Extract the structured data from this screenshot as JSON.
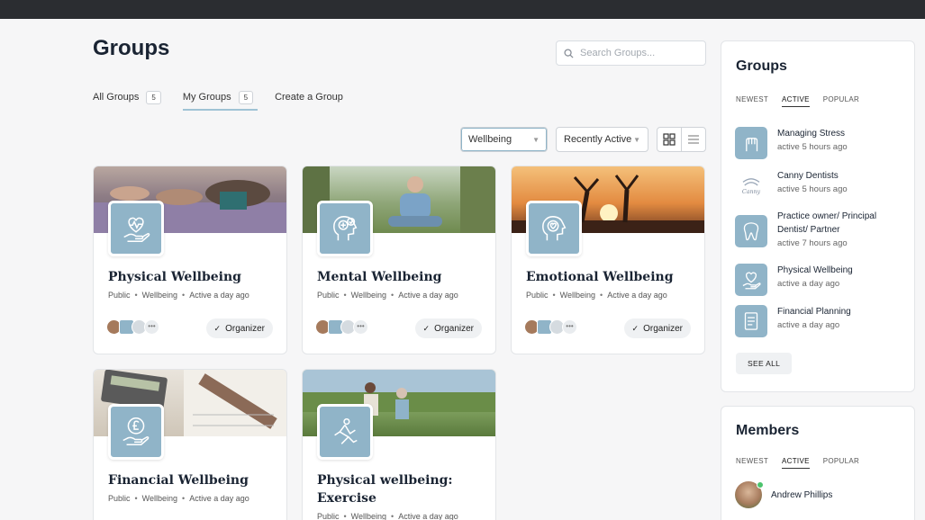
{
  "page": {
    "title": "Groups"
  },
  "search": {
    "placeholder": "Search Groups..."
  },
  "tabs": [
    {
      "label": "All Groups",
      "count": "5"
    },
    {
      "label": "My Groups",
      "count": "5"
    },
    {
      "label": "Create a Group"
    }
  ],
  "filters": {
    "category": "Wellbeing",
    "sort": "Recently Active"
  },
  "groups": [
    {
      "title": "Physical Wellbeing",
      "privacy": "Public",
      "type": "Wellbeing",
      "activity": "Active a day ago",
      "role": "Organizer",
      "icon": "heart-hand-icon"
    },
    {
      "title": "Mental Wellbeing",
      "privacy": "Public",
      "type": "Wellbeing",
      "activity": "Active a day ago",
      "role": "Organizer",
      "icon": "head-plus-icon"
    },
    {
      "title": "Emotional Wellbeing",
      "privacy": "Public",
      "type": "Wellbeing",
      "activity": "Active a day ago",
      "role": "Organizer",
      "icon": "head-heart-icon"
    },
    {
      "title": "Financial Wellbeing",
      "privacy": "Public",
      "type": "Wellbeing",
      "activity": "Active a day ago",
      "icon": "pound-hand-icon"
    },
    {
      "title": "Physical wellbeing: Exercise",
      "privacy": "Public",
      "type": "Wellbeing",
      "activity": "Active a day ago",
      "icon": "yoga-pose-icon"
    }
  ],
  "sidebar_groups": {
    "title": "Groups",
    "tabs": [
      "NEWEST",
      "ACTIVE",
      "POPULAR"
    ],
    "items": [
      {
        "name": "Managing Stress",
        "activity": "active 5 hours ago"
      },
      {
        "name": "Canny Dentists",
        "activity": "active 5 hours ago",
        "logo_text": "Canny"
      },
      {
        "name": "Practice owner/ Principal Dentist/ Partner",
        "activity": "active 7 hours ago"
      },
      {
        "name": "Physical Wellbeing",
        "activity": "active a day ago"
      },
      {
        "name": "Financial Planning",
        "activity": "active a day ago"
      }
    ],
    "see_all": "SEE ALL"
  },
  "sidebar_members": {
    "title": "Members",
    "tabs": [
      "NEWEST",
      "ACTIVE",
      "POPULAR"
    ],
    "items": [
      {
        "name": "Andrew Phillips"
      }
    ]
  },
  "colors": {
    "icon_bg": "#90b4c8",
    "accent_underline": "#9fc3d5",
    "online": "#4cc36d"
  }
}
